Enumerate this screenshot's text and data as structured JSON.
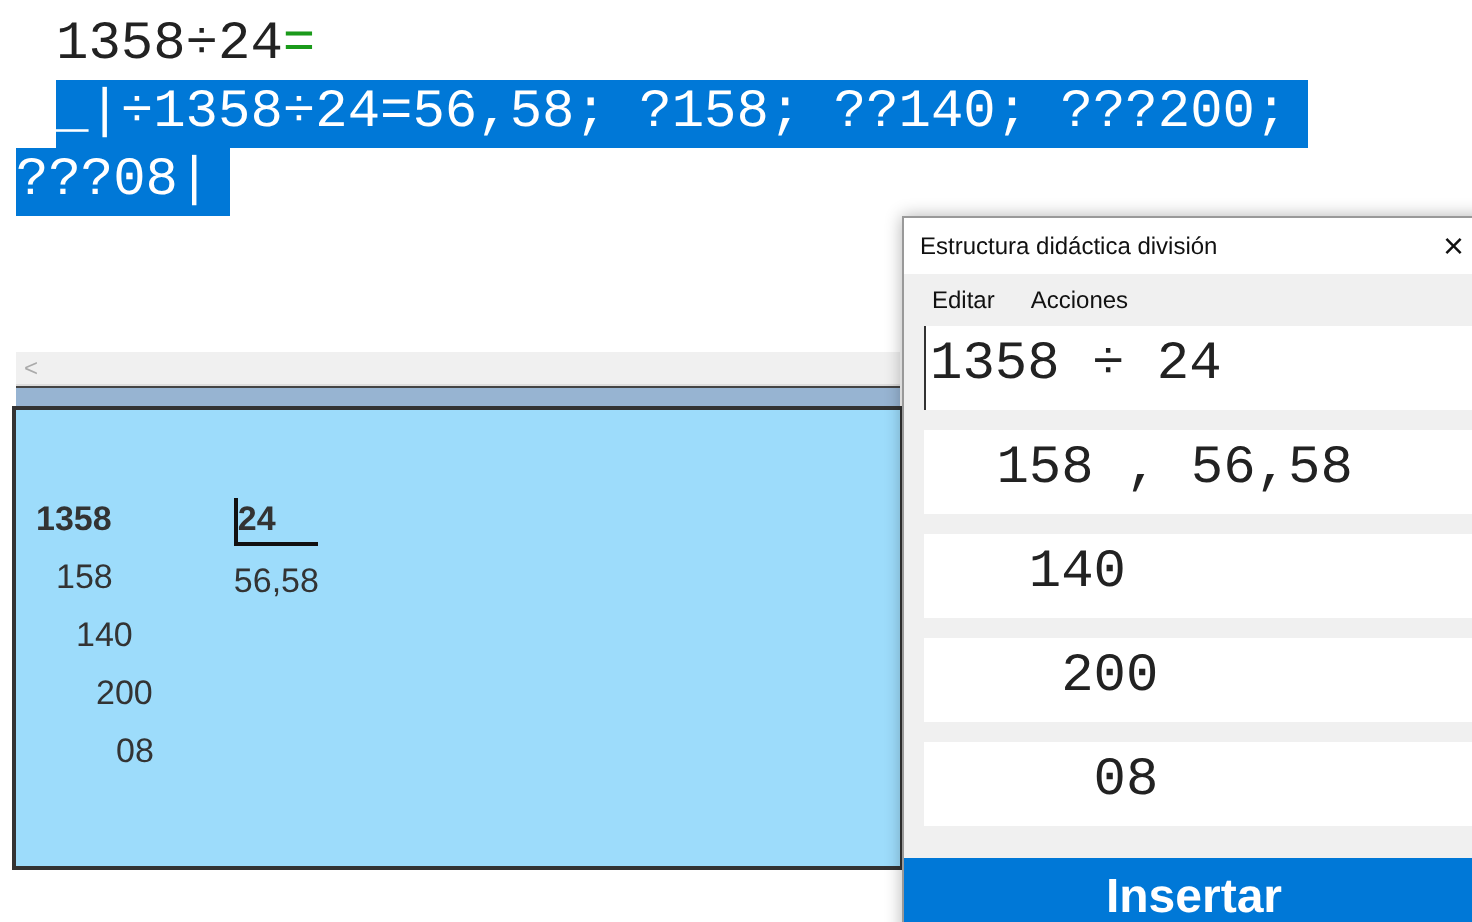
{
  "editor": {
    "expression": "1358÷24",
    "equals": "=",
    "result_lines": [
      {
        "text": "_|÷1358÷24=56,58; ?158; ??140; ???200;",
        "selected": true
      },
      {
        "text": "???08|",
        "selected": true
      }
    ]
  },
  "scrollbar": {
    "left_arrow": "<"
  },
  "division_panel": {
    "dividend": "1358",
    "divisor": "24",
    "quotient": "56,58",
    "remainders": [
      "158",
      "140",
      "200",
      "08"
    ]
  },
  "dialog": {
    "title": "Estructura didáctica división",
    "close": "×",
    "menu": [
      {
        "label": "Editar"
      },
      {
        "label": "Acciones"
      }
    ],
    "lines": [
      "1358 ÷ 24",
      " 158 , 56,58",
      "  140",
      "   200",
      "    08"
    ],
    "button": "Insertar"
  }
}
